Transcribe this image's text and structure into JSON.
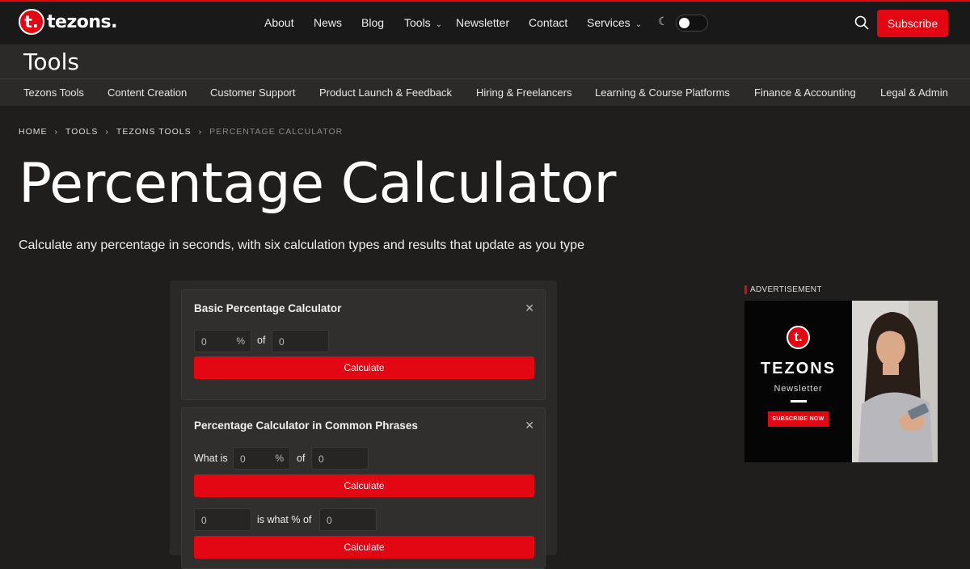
{
  "header": {
    "logo_letter": "t.",
    "logo_text": "tezons.",
    "nav": [
      "About",
      "News",
      "Blog",
      "Tools",
      "Newsletter",
      "Contact",
      "Services"
    ],
    "subscribe_label": "Subscribe",
    "accent_color": "#e30613"
  },
  "section": {
    "title": "Tools"
  },
  "categories": [
    "Tezons Tools",
    "Content Creation",
    "Customer Support",
    "Product Launch & Feedback",
    "Hiring & Freelancers",
    "Learning & Course Platforms",
    "Finance & Accounting",
    "Legal & Admin"
  ],
  "breadcrumb": [
    "HOME",
    "TOOLS",
    "TEZONS TOOLS",
    "PERCENTAGE CALCULATOR"
  ],
  "page": {
    "title": "Percentage Calculator",
    "subtitle": "Calculate any percentage in seconds, with six calculation types and results that update as you type"
  },
  "calc1": {
    "title": "Basic Percentage Calculator",
    "close": "✕",
    "field1": "0",
    "pct": "%",
    "of": "of",
    "field2": "0",
    "button": "Calculate"
  },
  "calc2": {
    "title": "Percentage Calculator in Common Phrases",
    "close": "✕",
    "what_is": "What is",
    "field1": "0",
    "pct": "%",
    "of": "of",
    "field2": "0",
    "button": "Calculate",
    "field3": "0",
    "is_what": "is what % of",
    "field4": "0",
    "button2": "Calculate"
  },
  "ad": {
    "label": "ADVERTISEMENT",
    "logo_letter": "t.",
    "brand": "TEZONS",
    "newsletter": "Newsletter",
    "cta": "SUBSCRIBE NOW"
  }
}
